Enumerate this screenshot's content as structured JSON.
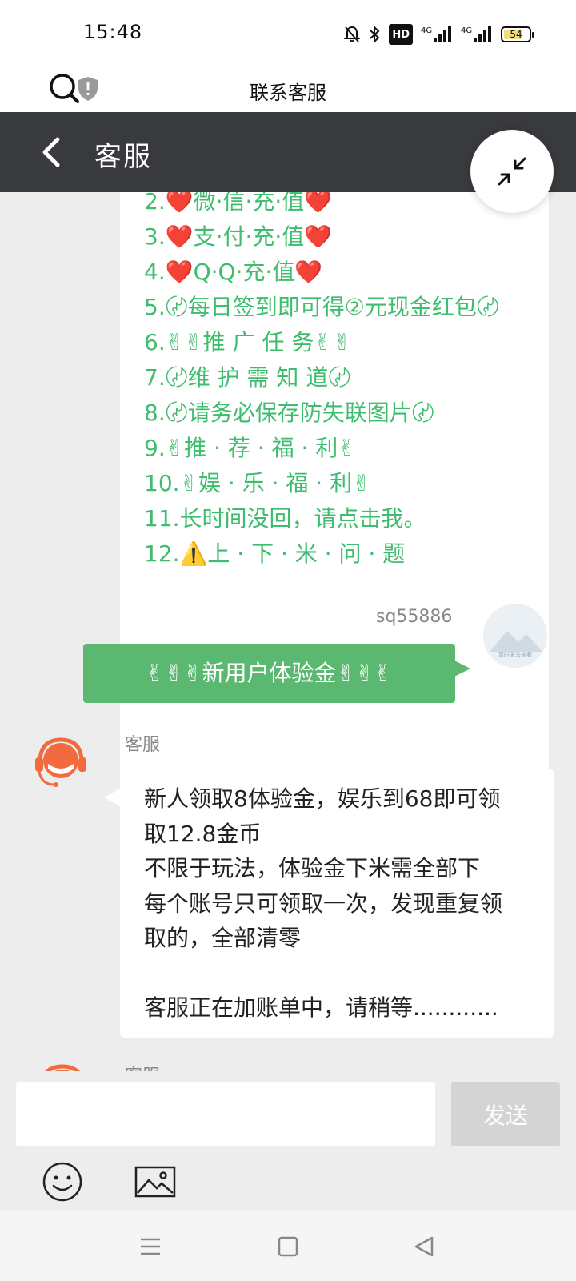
{
  "status_bar": {
    "time": "15:48",
    "icons": [
      "mute-bell-icon",
      "bluetooth-icon",
      "hd-icon",
      "signal-4g-icon",
      "signal-4g-icon"
    ],
    "hd_label": "HD",
    "net1": "4G",
    "net2": "4G",
    "battery": "54"
  },
  "web_bar": {
    "title": "联系客服"
  },
  "header": {
    "title": "客服"
  },
  "menu": {
    "items": [
      "2.❤️微·信·充·值❤️",
      "3.❤️支·付·充·值❤️",
      "4.❤️Q·Q·充·值❤️",
      "5.〄每日签到即可得②元现金红包〄",
      "6.✌✌推 广 任 务✌✌",
      "7.〄维 护 需 知 道〄",
      "8.〄请务必保存防失联图片〄",
      "9.✌推 · 荐 · 福 · 利✌",
      "10.✌娱 · 乐 · 福 · 利✌",
      "11.长时间没回，请点击我。",
      "12.⚠️上 · 下 · 米 · 问 · 题"
    ]
  },
  "user_message": {
    "username": "sq55886",
    "text": "✌✌✌新用户体验金✌✌✌",
    "avatar_caption": "暂时无法查看"
  },
  "agent_message": {
    "name": "客服",
    "lines": [
      "新人领取8体验金，娱乐到68即可领",
      "取12.8金币",
      "不限于玩法，体验金下米需全部下",
      "每个账号只可领取一次，发现重复领",
      "取的，全部清零",
      "",
      "客服正在加账单中，请稍等............"
    ]
  },
  "agent_message_2": {
    "name": "客服"
  },
  "input": {
    "placeholder": "",
    "value": "",
    "send_label": "发送"
  },
  "colors": {
    "header_bg": "#393a3e",
    "menu_text": "#3ebd6e",
    "user_bubble": "#5bb870",
    "agent_avatar": "#f26a3d"
  }
}
